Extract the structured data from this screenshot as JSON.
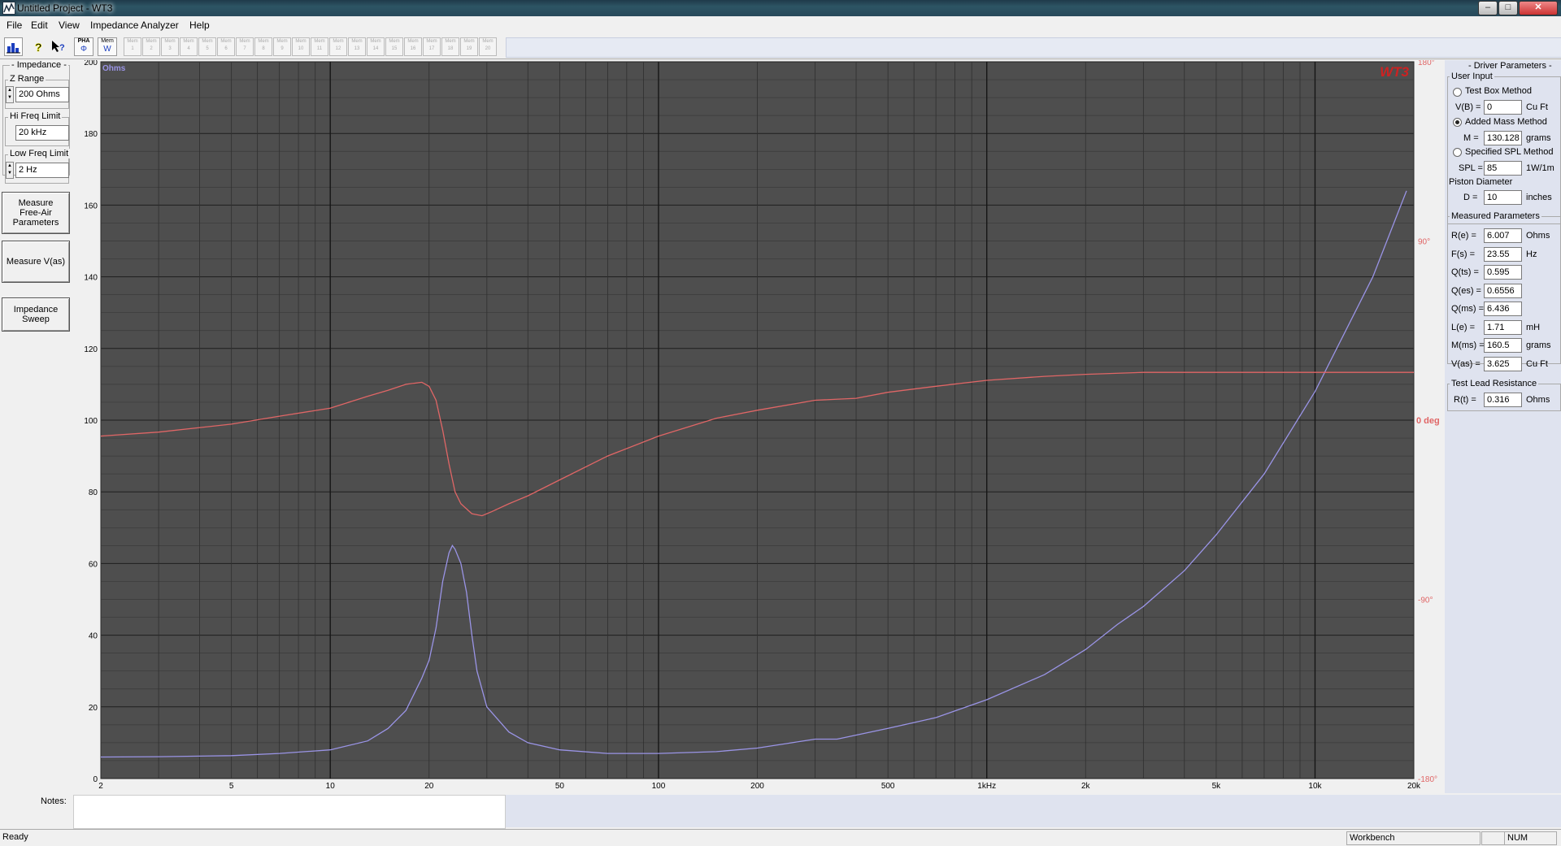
{
  "window": {
    "title": "Untitled Project - WT3",
    "minimize": "–",
    "maximize": "□",
    "close": "✕"
  },
  "menu": [
    "File",
    "Edit",
    "View",
    "Impedance Analyzer",
    "Help"
  ],
  "toolbar": {
    "icons": [
      "chart-icon",
      "help-icon",
      "context-help-icon"
    ],
    "pha_label": "PHA",
    "mem_label": "Mem",
    "mem_slots": [
      "1",
      "2",
      "3",
      "4",
      "5",
      "6",
      "7",
      "8",
      "9",
      "10",
      "11",
      "12",
      "13",
      "14",
      "15",
      "16",
      "17",
      "18",
      "19",
      "20"
    ]
  },
  "left_panel": {
    "group_title": "- Impedance -",
    "z_range_label": "Z Range",
    "z_range_value": "200 Ohms",
    "hi_freq_label": "Hi Freq Limit",
    "hi_freq_value": "20 kHz",
    "low_freq_label": "Low Freq Limit",
    "low_freq_value": "2 Hz",
    "measure_free_air": "Measure Free-Air Parameters",
    "measure_vas": "Measure V(as)",
    "impedance_sweep": "Impedance Sweep"
  },
  "right_panel": {
    "title": "- Driver Parameters -",
    "user_input": "User Input",
    "test_box_method": "Test Box Method",
    "vb_label": "V(B) =",
    "vb_value": "0",
    "vb_unit": "Cu Ft",
    "added_mass_method": "Added Mass Method",
    "m_label": "M =",
    "m_value": "130.128",
    "m_unit": "grams",
    "spl_method": "Specified SPL Method",
    "spl_label": "SPL =",
    "spl_value": "85",
    "spl_unit": "1W/1m",
    "piston_diameter": "Piston Diameter",
    "d_label": "D =",
    "d_value": "10",
    "d_unit": "inches",
    "measured_title": "Measured Parameters",
    "measured": [
      {
        "label": "R(e) =",
        "value": "6.007",
        "unit": "Ohms"
      },
      {
        "label": "F(s) =",
        "value": "23.55",
        "unit": "Hz"
      },
      {
        "label": "Q(ts) =",
        "value": "0.595",
        "unit": ""
      },
      {
        "label": "Q(es) =",
        "value": "0.6556",
        "unit": ""
      },
      {
        "label": "Q(ms) =",
        "value": "6.436",
        "unit": ""
      },
      {
        "label": "L(e) =",
        "value": "1.71",
        "unit": "mH"
      },
      {
        "label": "M(ms) =",
        "value": "160.5",
        "unit": "grams"
      },
      {
        "label": "V(as) =",
        "value": "3.625",
        "unit": "Cu Ft"
      }
    ],
    "test_lead_title": "Test Lead Resistance",
    "rt_label": "R(t) =",
    "rt_value": "0.316",
    "rt_unit": "Ohms"
  },
  "notes_label": "Notes:",
  "status": {
    "ready": "Ready",
    "workbench": "Workbench",
    "num": "NUM"
  },
  "colors": {
    "plot_bg": "#4e4e4e",
    "impedance": "#9a94e6",
    "phase": "#e06666",
    "wt3_logo": "#cc2222"
  },
  "chart_data": {
    "type": "line",
    "logo": "WT3",
    "x_scale": "log",
    "xlim": [
      2,
      20000
    ],
    "ylim": [
      0,
      200
    ],
    "y2lim": [
      -180,
      180
    ],
    "ylabel": "Ohms",
    "y2_zero_label": "0 deg",
    "x_ticks": [
      {
        "v": 2,
        "label": "2"
      },
      {
        "v": 5,
        "label": "5"
      },
      {
        "v": 10,
        "label": "10"
      },
      {
        "v": 20,
        "label": "20"
      },
      {
        "v": 50,
        "label": "50"
      },
      {
        "v": 100,
        "label": "100"
      },
      {
        "v": 200,
        "label": "200"
      },
      {
        "v": 500,
        "label": "500"
      },
      {
        "v": 1000,
        "label": "1kHz"
      },
      {
        "v": 2000,
        "label": "2k"
      },
      {
        "v": 5000,
        "label": "5k"
      },
      {
        "v": 10000,
        "label": "10k"
      },
      {
        "v": 20000,
        "label": "20k"
      }
    ],
    "y_ticks": [
      0,
      20,
      40,
      60,
      80,
      100,
      120,
      140,
      160,
      180,
      200
    ],
    "y2_ticks": [
      {
        "v": 180,
        "label": "180°"
      },
      {
        "v": 90,
        "label": "90°"
      },
      {
        "v": 0,
        "label": "0 deg"
      },
      {
        "v": -90,
        "label": "-90°"
      },
      {
        "v": -180,
        "label": "-180°"
      }
    ],
    "series": [
      {
        "axis": "left",
        "x": [
          2,
          3,
          5,
          7,
          10,
          13,
          15,
          17,
          19,
          20,
          21,
          22,
          23,
          23.55,
          24,
          25,
          26,
          27,
          28,
          30,
          35,
          40,
          50,
          70,
          100,
          150,
          200,
          300,
          350,
          500,
          700,
          1000,
          1500,
          2000,
          2500,
          3000,
          4000,
          5000,
          7000,
          10000,
          15000,
          19000
        ],
        "y": [
          6,
          6.1,
          6.4,
          7,
          8,
          10.5,
          14,
          19,
          28,
          33,
          42,
          55,
          63,
          65,
          64,
          60,
          52,
          40,
          30,
          20,
          13,
          10,
          8,
          7,
          7,
          7.5,
          8.5,
          11,
          11,
          14,
          17,
          22,
          29,
          36,
          43,
          48,
          58,
          68,
          85,
          108,
          140,
          164
        ]
      },
      {
        "axis": "right",
        "x": [
          2,
          3,
          5,
          7,
          10,
          13,
          15,
          17,
          19,
          20,
          21,
          22,
          23,
          24,
          25,
          27,
          29,
          31,
          35,
          40,
          50,
          70,
          100,
          150,
          200,
          300,
          400,
          500,
          700,
          1000,
          1500,
          2000,
          3000,
          5000,
          10000,
          20000
        ],
        "y": [
          -8,
          -6,
          -2,
          2,
          6,
          12,
          15,
          18,
          19,
          17,
          10,
          -5,
          -22,
          -36,
          -42,
          -47,
          -48,
          -46,
          -42,
          -38,
          -30,
          -18,
          -8,
          1,
          5,
          10,
          11,
          14,
          17,
          20,
          22,
          23,
          24,
          24,
          24,
          24
        ]
      }
    ]
  }
}
